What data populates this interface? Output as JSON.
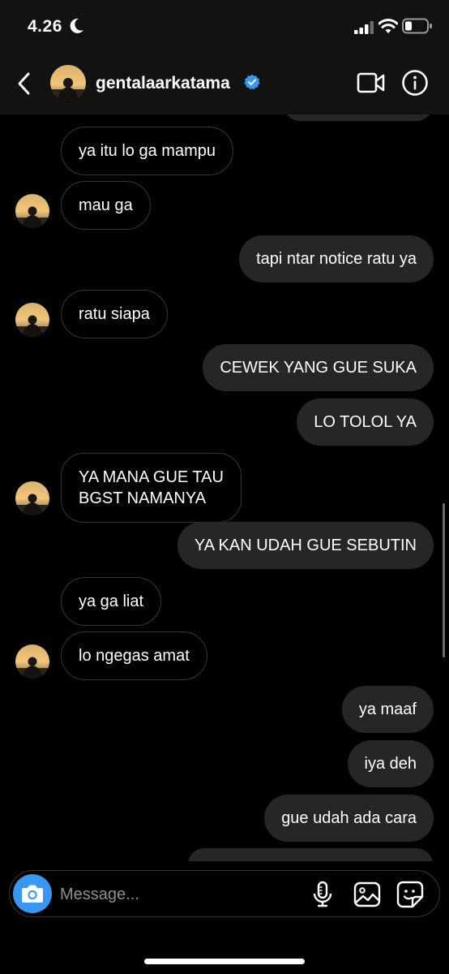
{
  "status_bar": {
    "time": "4.26"
  },
  "header": {
    "username": "gentalaarkatama"
  },
  "messages": [
    {
      "side": "in",
      "text": "ya itu lo ga mampu",
      "avatar": false
    },
    {
      "side": "in",
      "text": "mau ga",
      "avatar": true
    },
    {
      "side": "out",
      "text": "tapi ntar notice ratu ya"
    },
    {
      "side": "in",
      "text": "ratu siapa",
      "avatar": true
    },
    {
      "side": "out",
      "text": "CEWEK YANG GUE SUKA"
    },
    {
      "side": "out",
      "text": "LO TOLOL YA"
    },
    {
      "side": "in",
      "text": "YA MANA GUE TAU\nBGST NAMANYA",
      "avatar": true
    },
    {
      "side": "out",
      "text": "YA KAN UDAH GUE SEBUTIN"
    },
    {
      "side": "in",
      "text": "ya ga liat",
      "avatar": false
    },
    {
      "side": "in",
      "text": "lo ngegas amat",
      "avatar": true
    },
    {
      "side": "out",
      "text": "ya maaf"
    },
    {
      "side": "out",
      "text": "iya deh"
    },
    {
      "side": "out",
      "text": "gue udah ada cara"
    }
  ],
  "composer": {
    "placeholder": "Message..."
  },
  "icons": {
    "back": "chevron-left-icon",
    "video": "video-call-icon",
    "info": "info-icon",
    "verified": "verified-badge-icon",
    "camera": "camera-icon",
    "mic": "microphone-icon",
    "gallery": "gallery-icon",
    "sticker": "sticker-icon"
  },
  "colors": {
    "accent": "#3897f0",
    "outgoing_bubble": "#262626",
    "incoming_border": "#363636",
    "header": "#121212"
  }
}
